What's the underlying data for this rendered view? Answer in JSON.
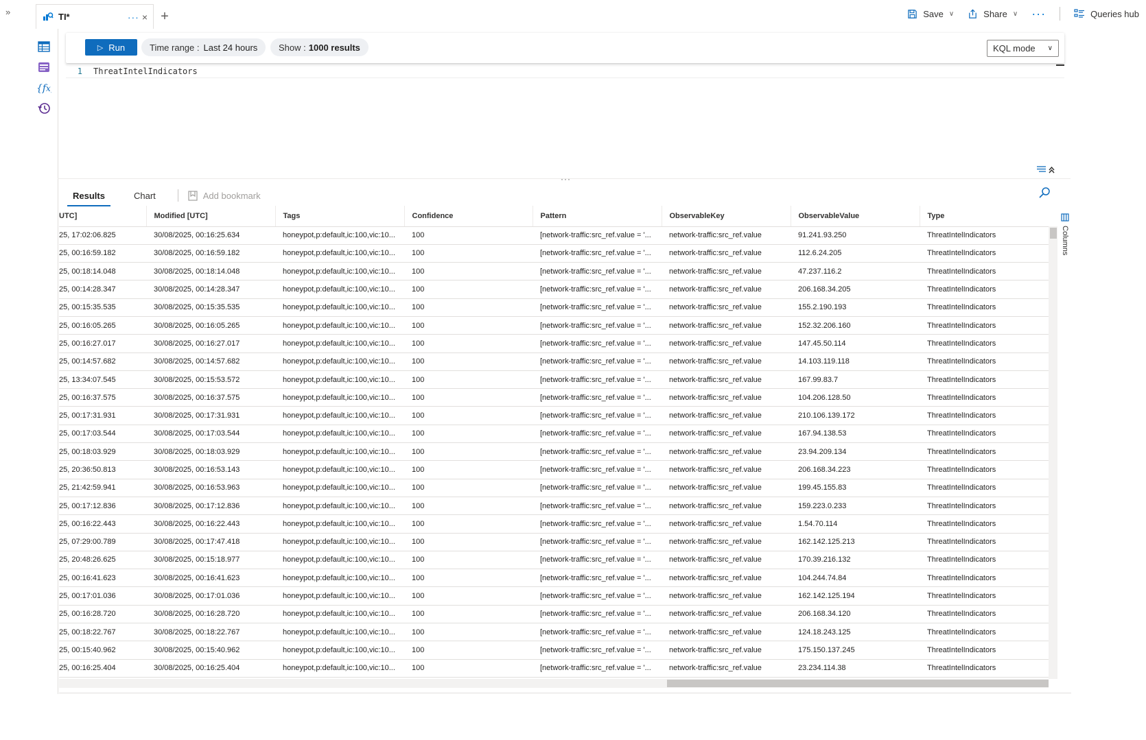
{
  "tabs": {
    "active_title": "TI*",
    "more_label": "···",
    "close_label": "×",
    "add_label": "+"
  },
  "toolbar": {
    "save_label": "Save",
    "share_label": "Share",
    "more_label": "···",
    "queries_hub_label": "Queries hub"
  },
  "query_bar": {
    "run_label": "Run",
    "time_range_label": "Time range :",
    "time_range_value": "Last 24 hours",
    "show_label": "Show :",
    "show_value": "1000 results",
    "mode_value": "KQL mode"
  },
  "editor": {
    "line_number": "1",
    "code": "ThreatIntelIndicators"
  },
  "results": {
    "tab_results": "Results",
    "tab_chart": "Chart",
    "add_bookmark": "Add bookmark",
    "columns_label": "Columns",
    "columns": [
      "UTC]",
      "Modified [UTC]",
      "Tags",
      "Confidence",
      "Pattern",
      "ObservableKey",
      "ObservableValue",
      "Type"
    ],
    "rows": [
      [
        "25, 17:02:06.825",
        "30/08/2025, 00:16:25.634",
        "honeypot,p:default,ic:100,vic:10...",
        "100",
        "[network-traffic:src_ref.value = '...",
        "network-traffic:src_ref.value",
        "91.241.93.250",
        "ThreatIntelIndicators"
      ],
      [
        "25, 00:16:59.182",
        "30/08/2025, 00:16:59.182",
        "honeypot,p:default,ic:100,vic:10...",
        "100",
        "[network-traffic:src_ref.value = '...",
        "network-traffic:src_ref.value",
        "112.6.24.205",
        "ThreatIntelIndicators"
      ],
      [
        "25, 00:18:14.048",
        "30/08/2025, 00:18:14.048",
        "honeypot,p:default,ic:100,vic:10...",
        "100",
        "[network-traffic:src_ref.value = '...",
        "network-traffic:src_ref.value",
        "47.237.116.2",
        "ThreatIntelIndicators"
      ],
      [
        "25, 00:14:28.347",
        "30/08/2025, 00:14:28.347",
        "honeypot,p:default,ic:100,vic:10...",
        "100",
        "[network-traffic:src_ref.value = '...",
        "network-traffic:src_ref.value",
        "206.168.34.205",
        "ThreatIntelIndicators"
      ],
      [
        "25, 00:15:35.535",
        "30/08/2025, 00:15:35.535",
        "honeypot,p:default,ic:100,vic:10...",
        "100",
        "[network-traffic:src_ref.value = '...",
        "network-traffic:src_ref.value",
        "155.2.190.193",
        "ThreatIntelIndicators"
      ],
      [
        "25, 00:16:05.265",
        "30/08/2025, 00:16:05.265",
        "honeypot,p:default,ic:100,vic:10...",
        "100",
        "[network-traffic:src_ref.value = '...",
        "network-traffic:src_ref.value",
        "152.32.206.160",
        "ThreatIntelIndicators"
      ],
      [
        "25, 00:16:27.017",
        "30/08/2025, 00:16:27.017",
        "honeypot,p:default,ic:100,vic:10...",
        "100",
        "[network-traffic:src_ref.value = '...",
        "network-traffic:src_ref.value",
        "147.45.50.114",
        "ThreatIntelIndicators"
      ],
      [
        "25, 00:14:57.682",
        "30/08/2025, 00:14:57.682",
        "honeypot,p:default,ic:100,vic:10...",
        "100",
        "[network-traffic:src_ref.value = '...",
        "network-traffic:src_ref.value",
        "14.103.119.118",
        "ThreatIntelIndicators"
      ],
      [
        "25, 13:34:07.545",
        "30/08/2025, 00:15:53.572",
        "honeypot,p:default,ic:100,vic:10...",
        "100",
        "[network-traffic:src_ref.value = '...",
        "network-traffic:src_ref.value",
        "167.99.83.7",
        "ThreatIntelIndicators"
      ],
      [
        "25, 00:16:37.575",
        "30/08/2025, 00:16:37.575",
        "honeypot,p:default,ic:100,vic:10...",
        "100",
        "[network-traffic:src_ref.value = '...",
        "network-traffic:src_ref.value",
        "104.206.128.50",
        "ThreatIntelIndicators"
      ],
      [
        "25, 00:17:31.931",
        "30/08/2025, 00:17:31.931",
        "honeypot,p:default,ic:100,vic:10...",
        "100",
        "[network-traffic:src_ref.value = '...",
        "network-traffic:src_ref.value",
        "210.106.139.172",
        "ThreatIntelIndicators"
      ],
      [
        "25, 00:17:03.544",
        "30/08/2025, 00:17:03.544",
        "honeypot,p:default,ic:100,vic:10...",
        "100",
        "[network-traffic:src_ref.value = '...",
        "network-traffic:src_ref.value",
        "167.94.138.53",
        "ThreatIntelIndicators"
      ],
      [
        "25, 00:18:03.929",
        "30/08/2025, 00:18:03.929",
        "honeypot,p:default,ic:100,vic:10...",
        "100",
        "[network-traffic:src_ref.value = '...",
        "network-traffic:src_ref.value",
        "23.94.209.134",
        "ThreatIntelIndicators"
      ],
      [
        "25, 20:36:50.813",
        "30/08/2025, 00:16:53.143",
        "honeypot,p:default,ic:100,vic:10...",
        "100",
        "[network-traffic:src_ref.value = '...",
        "network-traffic:src_ref.value",
        "206.168.34.223",
        "ThreatIntelIndicators"
      ],
      [
        "25, 21:42:59.941",
        "30/08/2025, 00:16:53.963",
        "honeypot,p:default,ic:100,vic:10...",
        "100",
        "[network-traffic:src_ref.value = '...",
        "network-traffic:src_ref.value",
        "199.45.155.83",
        "ThreatIntelIndicators"
      ],
      [
        "25, 00:17:12.836",
        "30/08/2025, 00:17:12.836",
        "honeypot,p:default,ic:100,vic:10...",
        "100",
        "[network-traffic:src_ref.value = '...",
        "network-traffic:src_ref.value",
        "159.223.0.233",
        "ThreatIntelIndicators"
      ],
      [
        "25, 00:16:22.443",
        "30/08/2025, 00:16:22.443",
        "honeypot,p:default,ic:100,vic:10...",
        "100",
        "[network-traffic:src_ref.value = '...",
        "network-traffic:src_ref.value",
        "1.54.70.114",
        "ThreatIntelIndicators"
      ],
      [
        "25, 07:29:00.789",
        "30/08/2025, 00:17:47.418",
        "honeypot,p:default,ic:100,vic:10...",
        "100",
        "[network-traffic:src_ref.value = '...",
        "network-traffic:src_ref.value",
        "162.142.125.213",
        "ThreatIntelIndicators"
      ],
      [
        "25, 20:48:26.625",
        "30/08/2025, 00:15:18.977",
        "honeypot,p:default,ic:100,vic:10...",
        "100",
        "[network-traffic:src_ref.value = '...",
        "network-traffic:src_ref.value",
        "170.39.216.132",
        "ThreatIntelIndicators"
      ],
      [
        "25, 00:16:41.623",
        "30/08/2025, 00:16:41.623",
        "honeypot,p:default,ic:100,vic:10...",
        "100",
        "[network-traffic:src_ref.value = '...",
        "network-traffic:src_ref.value",
        "104.244.74.84",
        "ThreatIntelIndicators"
      ],
      [
        "25, 00:17:01.036",
        "30/08/2025, 00:17:01.036",
        "honeypot,p:default,ic:100,vic:10...",
        "100",
        "[network-traffic:src_ref.value = '...",
        "network-traffic:src_ref.value",
        "162.142.125.194",
        "ThreatIntelIndicators"
      ],
      [
        "25, 00:16:28.720",
        "30/08/2025, 00:16:28.720",
        "honeypot,p:default,ic:100,vic:10...",
        "100",
        "[network-traffic:src_ref.value = '...",
        "network-traffic:src_ref.value",
        "206.168.34.120",
        "ThreatIntelIndicators"
      ],
      [
        "25, 00:18:22.767",
        "30/08/2025, 00:18:22.767",
        "honeypot,p:default,ic:100,vic:10...",
        "100",
        "[network-traffic:src_ref.value = '...",
        "network-traffic:src_ref.value",
        "124.18.243.125",
        "ThreatIntelIndicators"
      ],
      [
        "25, 00:15:40.962",
        "30/08/2025, 00:15:40.962",
        "honeypot,p:default,ic:100,vic:10...",
        "100",
        "[network-traffic:src_ref.value = '...",
        "network-traffic:src_ref.value",
        "175.150.137.245",
        "ThreatIntelIndicators"
      ],
      [
        "25, 00:16:25.404",
        "30/08/2025, 00:16:25.404",
        "honeypot,p:default,ic:100,vic:10...",
        "100",
        "[network-traffic:src_ref.value = '...",
        "network-traffic:src_ref.value",
        "23.234.114.38",
        "ThreatIntelIndicators"
      ]
    ]
  },
  "colors": {
    "accent": "#0f6cbd",
    "link_blue": "#0078d4",
    "rail_purple": "#5c2d91"
  },
  "icons": {
    "collapse": "double-chevron-right-icon",
    "tab": "log-analytics-icon",
    "save": "save-icon",
    "share": "share-icon",
    "queries_hub": "queries-hub-icon",
    "rail": [
      "tables-icon",
      "queries-icon",
      "functions-icon",
      "history-icon"
    ],
    "search": "search-icon",
    "bookmark": "bookmark-icon",
    "columns": "columns-icon"
  }
}
